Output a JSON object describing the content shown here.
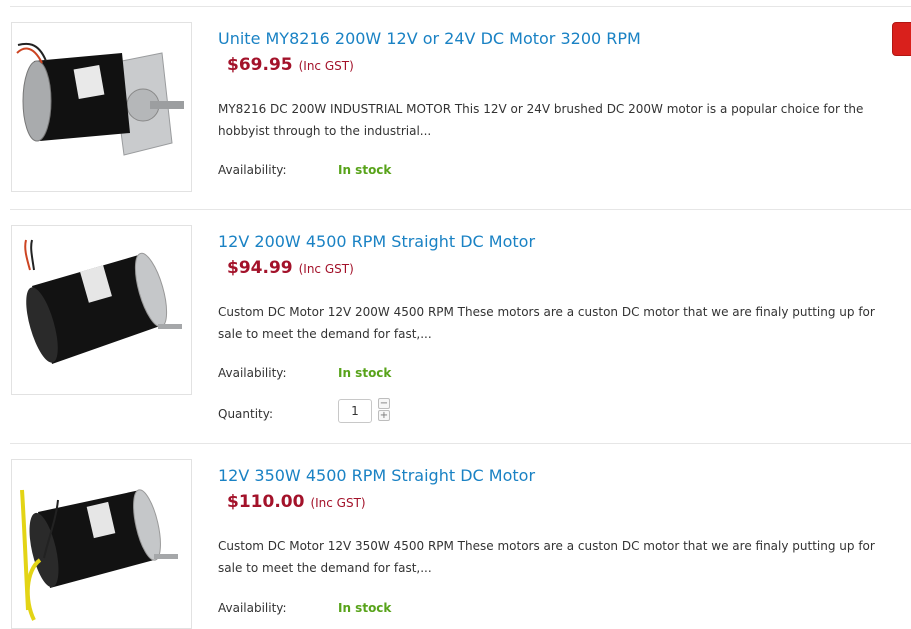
{
  "products": [
    {
      "title": "Unite MY8216 200W 12V or 24V DC Motor 3200 RPM",
      "price": "$69.95",
      "gst": "(Inc GST)",
      "description": "MY8216 DC 200W INDUSTRIAL MOTOR   This 12V or 24V brushed DC 200W motor is a popular choice for the hobbyist through to the industrial...",
      "availability_label": "Availability:",
      "availability_value": "In stock"
    },
    {
      "title": "12V 200W 4500 RPM Straight DC Motor",
      "price": "$94.99",
      "gst": "(Inc GST)",
      "description": "Custom DC Motor 12V 200W 4500 RPM   These motors are a custon DC motor that we are finaly putting up for sale to meet the demand for fast,...",
      "availability_label": "Availability:",
      "availability_value": "In stock",
      "quantity_label": "Quantity:",
      "quantity_value": "1"
    },
    {
      "title": "12V 350W 4500 RPM Straight DC Motor",
      "price": "$110.00",
      "gst": "(Inc GST)",
      "description": "Custom DC Motor 12V 350W 4500 RPM   These motors are a custon DC motor that we are finaly putting up for sale to meet the demand for fast,...",
      "availability_label": "Availability:",
      "availability_value": "In stock"
    }
  ],
  "colors": {
    "title_link": "#1a82c4",
    "price": "#a3122a",
    "in_stock": "#58a31a",
    "cart_button": "#d9201c"
  }
}
